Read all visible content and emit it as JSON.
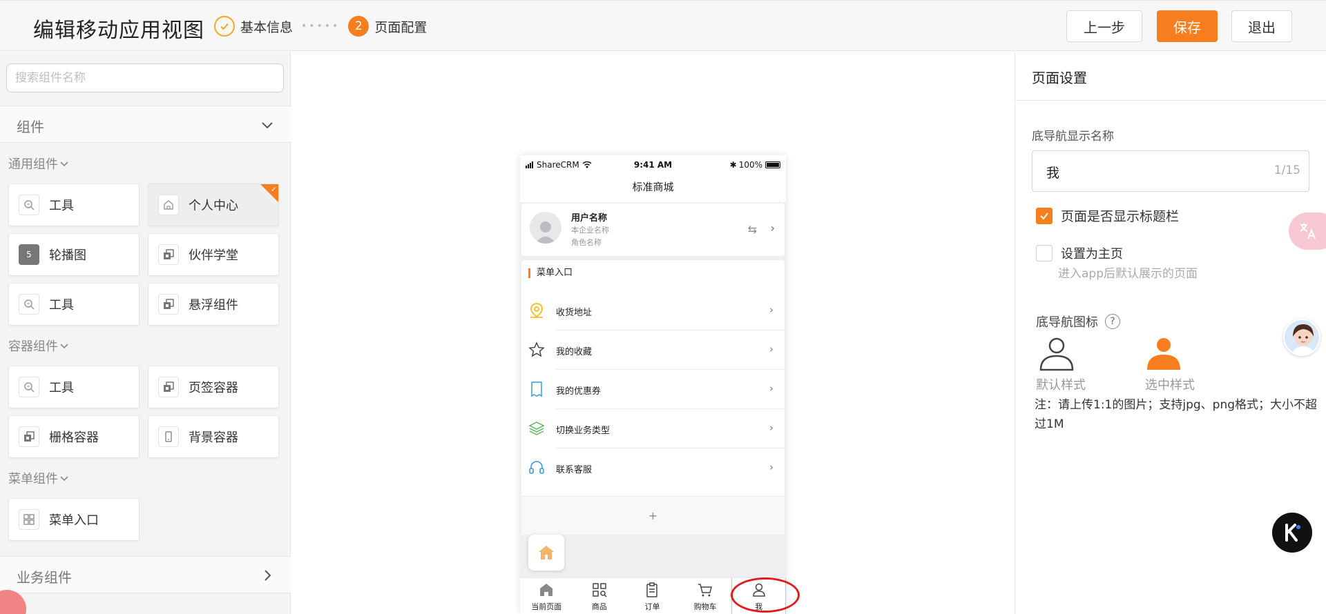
{
  "header": {
    "title": "编辑移动应用视图",
    "step1_label": "基本信息",
    "step2_number": "2",
    "step2_label": "页面配置",
    "prev_label": "上一步",
    "save_label": "保存",
    "exit_label": "退出"
  },
  "left": {
    "search_placeholder": "搜索组件名称",
    "components_header": "组件",
    "groups": {
      "common": {
        "title": "通用组件",
        "items": [
          "工具",
          "个人中心",
          "轮播图",
          "伙伴学堂",
          "工具",
          "悬浮组件"
        ],
        "carousel_badge": "5"
      },
      "container": {
        "title": "容器组件",
        "items": [
          "工具",
          "页签容器",
          "栅格容器",
          "背景容器"
        ]
      },
      "menu": {
        "title": "菜单组件",
        "items": [
          "菜单入口"
        ]
      }
    },
    "business_header": "业务组件"
  },
  "phone": {
    "carrier": "ShareCRM",
    "time": "9:41 AM",
    "battery": "100%",
    "nav_title": "标准商城",
    "user_name": "用户名称",
    "enterprise": "本企业名称",
    "role": "角色名称",
    "menu_title": "菜单入口",
    "menu_items": [
      "收货地址",
      "我的收藏",
      "我的优惠券",
      "切换业务类型",
      "联系客服"
    ],
    "add_symbol": "+",
    "tabs": [
      "当前页面",
      "商品",
      "订单",
      "购物车",
      "我"
    ]
  },
  "right": {
    "title": "页面设置",
    "nav_name_label": "底导航显示名称",
    "nav_name_value": "我",
    "nav_name_count": "1/15",
    "show_title_label": "页面是否显示标题栏",
    "set_home_label": "设置为主页",
    "set_home_hint": "进入app后默认展示的页面",
    "nav_icon_label": "底导航图标",
    "default_style": "默认样式",
    "selected_style": "选中样式",
    "note": "注：请上传1:1的图片；支持jpg、png格式；大小不超过1M"
  },
  "colors": {
    "accent": "#f67e1e",
    "highlight_circle": "#e21c1c"
  }
}
